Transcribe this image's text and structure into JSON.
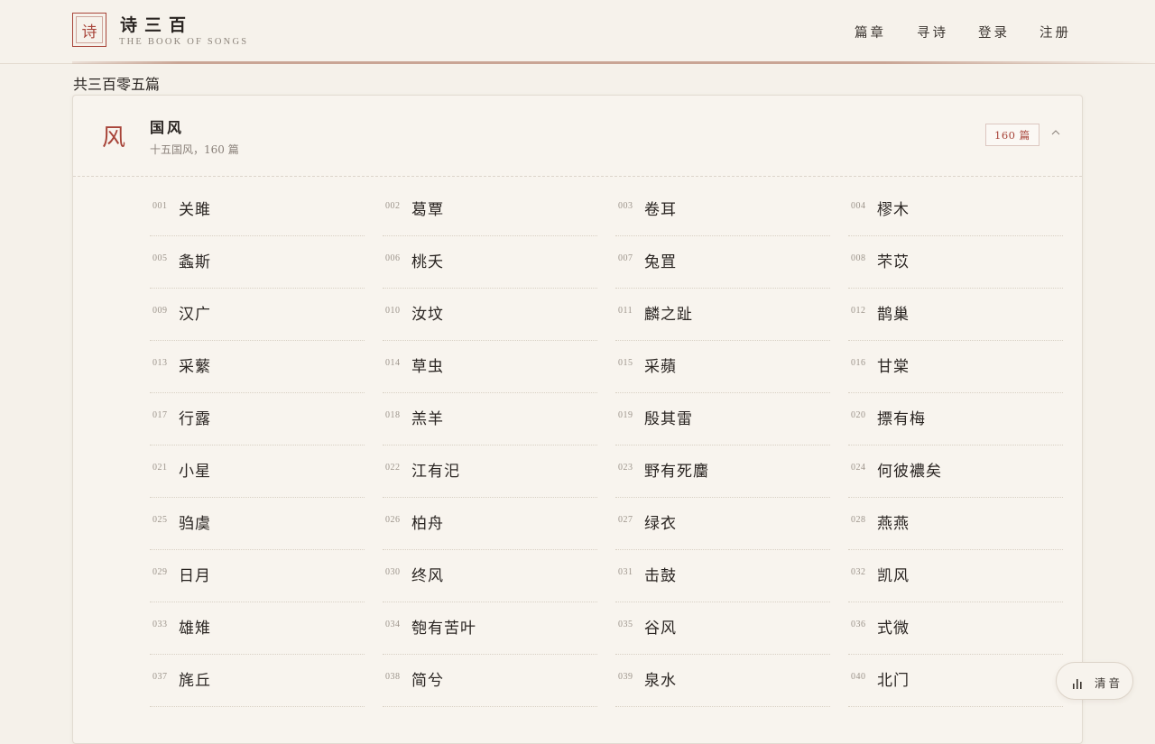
{
  "brand": {
    "seal_char": "诗",
    "title": "诗三百",
    "subtitle": "THE BOOK OF SONGS"
  },
  "nav": [
    "篇章",
    "寻诗",
    "登录",
    "注册"
  ],
  "total_label": "共三百零五篇",
  "section": {
    "glyph": "风",
    "title": "国风",
    "subtitle": "十五国风，160 篇",
    "badge": "160 篇",
    "toggle_icon": "chevron-up-icon"
  },
  "poems": [
    {
      "num": "001",
      "name": "关雎"
    },
    {
      "num": "002",
      "name": "葛覃"
    },
    {
      "num": "003",
      "name": "卷耳"
    },
    {
      "num": "004",
      "name": "樛木"
    },
    {
      "num": "005",
      "name": "螽斯"
    },
    {
      "num": "006",
      "name": "桃夭"
    },
    {
      "num": "007",
      "name": "兔罝"
    },
    {
      "num": "008",
      "name": "芣苡"
    },
    {
      "num": "009",
      "name": "汉广"
    },
    {
      "num": "010",
      "name": "汝坟"
    },
    {
      "num": "011",
      "name": "麟之趾"
    },
    {
      "num": "012",
      "name": "鹊巢"
    },
    {
      "num": "013",
      "name": "采蘩"
    },
    {
      "num": "014",
      "name": "草虫"
    },
    {
      "num": "015",
      "name": "采蘋"
    },
    {
      "num": "016",
      "name": "甘棠"
    },
    {
      "num": "017",
      "name": "行露"
    },
    {
      "num": "018",
      "name": "羔羊"
    },
    {
      "num": "019",
      "name": "殷其雷"
    },
    {
      "num": "020",
      "name": "摽有梅"
    },
    {
      "num": "021",
      "name": "小星"
    },
    {
      "num": "022",
      "name": "江有汜"
    },
    {
      "num": "023",
      "name": "野有死麕"
    },
    {
      "num": "024",
      "name": "何彼襛矣"
    },
    {
      "num": "025",
      "name": "驺虞"
    },
    {
      "num": "026",
      "name": "柏舟"
    },
    {
      "num": "027",
      "name": "绿衣"
    },
    {
      "num": "028",
      "name": "燕燕"
    },
    {
      "num": "029",
      "name": "日月"
    },
    {
      "num": "030",
      "name": "终风"
    },
    {
      "num": "031",
      "name": "击鼓"
    },
    {
      "num": "032",
      "name": "凯风"
    },
    {
      "num": "033",
      "name": "雄雉"
    },
    {
      "num": "034",
      "name": "匏有苦叶"
    },
    {
      "num": "035",
      "name": "谷风"
    },
    {
      "num": "036",
      "name": "式微"
    },
    {
      "num": "037",
      "name": "旄丘"
    },
    {
      "num": "038",
      "name": "简兮"
    },
    {
      "num": "039",
      "name": "泉水"
    },
    {
      "num": "040",
      "name": "北门"
    }
  ],
  "audio": {
    "icon": "audio-bars-icon",
    "label": "清音"
  },
  "colors": {
    "accent": "#a8453a",
    "background": "#f5f1ea",
    "card": "#f8f4ee"
  }
}
